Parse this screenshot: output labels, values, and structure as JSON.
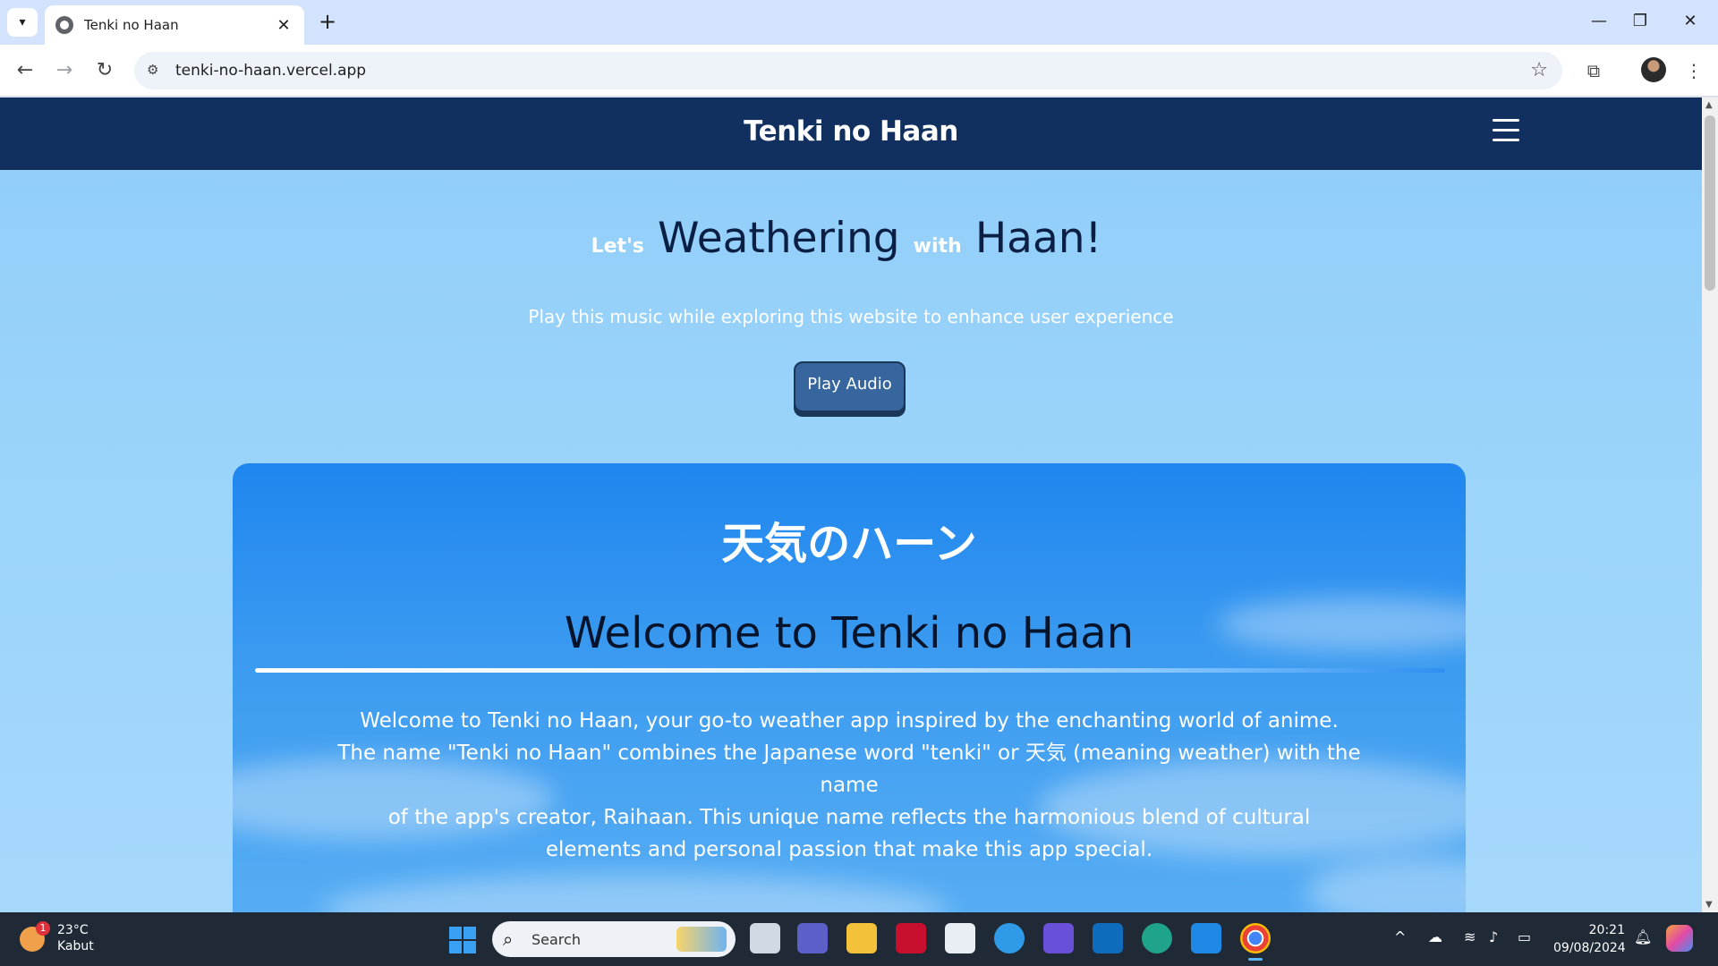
{
  "browser": {
    "tab_title": "Tenki no Haan",
    "url": "tenki-no-haan.vercel.app",
    "new_tab_symbol": "+",
    "close_symbol": "✕"
  },
  "site": {
    "header_title": "Tenki no Haan",
    "hero": {
      "lets": "Let's",
      "weathering": "Weathering",
      "with": "with",
      "haan": "Haan!"
    },
    "subtitle": "Play this music while exploring this website to enhance user experience",
    "play_button": "Play Audio",
    "card": {
      "japanese_title": "天気のハーン",
      "welcome_heading": "Welcome to Tenki no Haan",
      "body_lines": [
        "Welcome to Tenki no Haan, your go-to weather app inspired by the enchanting world of anime.",
        "The name \"Tenki no Haan\" combines the Japanese word \"tenki\" or 天気 (meaning weather) with the name",
        "of the app's creator, Raihaan. This unique name reflects the harmonious blend of cultural",
        "elements and personal passion that make this app special."
      ]
    }
  },
  "taskbar": {
    "weather_temp": "23°C",
    "weather_condition": "Kabut",
    "weather_badge": "1",
    "search_label": "Search",
    "time": "20:21",
    "date": "09/08/2024"
  },
  "colors": {
    "header_bg": "#12305f",
    "page_bg": "#8fcdf8",
    "button_bg": "#37659d",
    "card_bg": "#1f86ef",
    "taskbar_bg": "#1f2a36"
  }
}
